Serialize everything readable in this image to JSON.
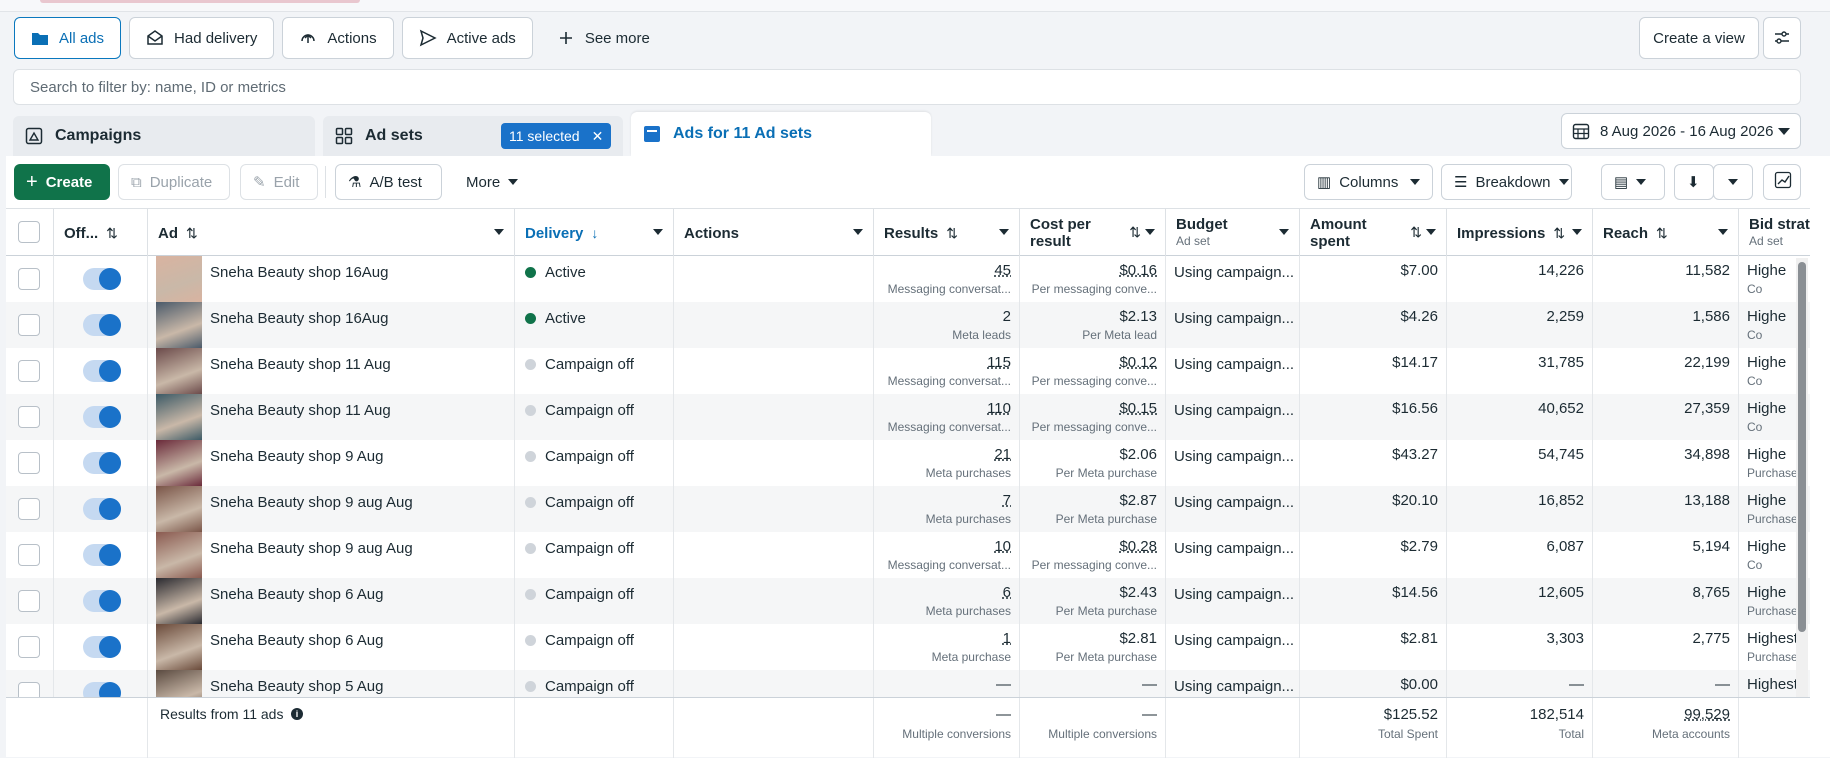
{
  "view_tabs": [
    {
      "label": "All ads",
      "icon": "folder-icon",
      "active": true
    },
    {
      "label": "Had delivery",
      "icon": "envelope-icon"
    },
    {
      "label": "Actions",
      "icon": "upload-circle-icon"
    },
    {
      "label": "Active ads",
      "icon": "send-icon"
    },
    {
      "label": "See more",
      "icon": "plus-icon"
    }
  ],
  "create_view_label": "Create a view",
  "search_placeholder": "Search to filter by: name, ID or metrics",
  "level_tabs": {
    "campaigns": "Campaigns",
    "adsets": "Ad sets",
    "selected_badge": "11 selected",
    "ads": "Ads for 11 Ad sets"
  },
  "date_range": "8 Aug 2026 - 16 Aug 2026",
  "toolbar": {
    "create": "Create",
    "duplicate": "Duplicate",
    "edit": "Edit",
    "ab_test": "A/B test",
    "more": "More",
    "columns": "Columns",
    "breakdown": "Breakdown"
  },
  "headers": {
    "off": "Off...",
    "ad": "Ad",
    "delivery": "Delivery",
    "actions": "Actions",
    "results": "Results",
    "cost_per_result_1": "Cost per",
    "cost_per_result_2": "result",
    "budget": "Budget",
    "budget_sub": "Ad set",
    "amount_1": "Amount",
    "amount_2": "spent",
    "impressions": "Impressions",
    "reach": "Reach",
    "bid": "Bid strateg",
    "bid_sub": "Ad set"
  },
  "rows": [
    {
      "name": "Sneha Beauty shop 16Aug",
      "delivery": "Active",
      "active": true,
      "results": "45",
      "results_sub": "Messaging conversat...",
      "cpr": "$0.16",
      "cpr_sub": "Per messaging conve...",
      "budget": "Using campaign...",
      "amount": "$7.00",
      "impressions": "14,226",
      "reach": "11,582",
      "bid": "Highe",
      "bid_sub": "Co",
      "thumb": "#d9b3a0"
    },
    {
      "name": "Sneha Beauty shop 16Aug",
      "delivery": "Active",
      "active": true,
      "results": "2",
      "results_sub": "Meta leads",
      "cpr": "$2.13",
      "cpr_sub": "Per Meta lead",
      "budget": "Using campaign...",
      "amount": "$4.26",
      "impressions": "2,259",
      "reach": "1,586",
      "bid": "Highe",
      "bid_sub": "Co",
      "thumb": "#4a5a6a"
    },
    {
      "name": "Sneha Beauty shop 11 Aug",
      "delivery": "Campaign off",
      "active": false,
      "results": "115",
      "results_sub": "Messaging conversat...",
      "cpr": "$0.12",
      "cpr_sub": "Per messaging conve...",
      "budget": "Using campaign...",
      "amount": "$14.17",
      "impressions": "31,785",
      "reach": "22,199",
      "bid": "Highe",
      "bid_sub": "Co",
      "thumb": "#6b4a4a"
    },
    {
      "name": "Sneha Beauty shop 11 Aug",
      "delivery": "Campaign off",
      "active": false,
      "results": "110",
      "results_sub": "Messaging conversat...",
      "cpr": "$0.15",
      "cpr_sub": "Per messaging conve...",
      "budget": "Using campaign...",
      "amount": "$16.56",
      "impressions": "40,652",
      "reach": "27,359",
      "bid": "Highe",
      "bid_sub": "Co",
      "thumb": "#3c5a66"
    },
    {
      "name": "Sneha Beauty shop 9 Aug",
      "delivery": "Campaign off",
      "active": false,
      "results": "21",
      "results_sub": "Meta purchases",
      "cpr": "$2.06",
      "cpr_sub": "Per Meta purchase",
      "budget": "Using campaign...",
      "amount": "$43.27",
      "impressions": "54,745",
      "reach": "34,898",
      "bid": "Highe",
      "bid_sub": "Purchase",
      "thumb": "#6a2a3a"
    },
    {
      "name": "Sneha Beauty shop 9 aug Aug",
      "delivery": "Campaign off",
      "active": false,
      "results": "7",
      "results_sub": "Meta purchases",
      "cpr": "$2.87",
      "cpr_sub": "Per Meta purchase",
      "budget": "Using campaign...",
      "amount": "$20.10",
      "impressions": "16,852",
      "reach": "13,188",
      "bid": "Highe",
      "bid_sub": "Purchase",
      "thumb": "#7a5548"
    },
    {
      "name": "Sneha Beauty shop 9 aug Aug",
      "delivery": "Campaign off",
      "active": false,
      "results": "10",
      "results_sub": "Messaging conversat...",
      "cpr": "$0.28",
      "cpr_sub": "Per messaging conve...",
      "budget": "Using campaign...",
      "amount": "$2.79",
      "impressions": "6,087",
      "reach": "5,194",
      "bid": "Highe",
      "bid_sub": "Co",
      "thumb": "#8a5a50"
    },
    {
      "name": "Sneha Beauty shop 6 Aug",
      "delivery": "Campaign off",
      "active": false,
      "results": "6",
      "results_sub": "Meta purchases",
      "cpr": "$2.43",
      "cpr_sub": "Per Meta purchase",
      "budget": "Using campaign...",
      "amount": "$14.56",
      "impressions": "12,605",
      "reach": "8,765",
      "bid": "Highe",
      "bid_sub": "Purchase",
      "thumb": "#2a2a30"
    },
    {
      "name": "Sneha Beauty shop 6 Aug",
      "delivery": "Campaign off",
      "active": false,
      "results": "1",
      "results_sub": "Meta purchase",
      "cpr": "$2.81",
      "cpr_sub": "Per Meta purchase",
      "budget": "Using campaign...",
      "amount": "$2.81",
      "impressions": "3,303",
      "reach": "2,775",
      "bid": "Highest",
      "bid_sub": "Purchase",
      "thumb": "#6a4a3a"
    },
    {
      "name": "Sneha Beauty shop 5 Aug",
      "delivery": "Campaign off",
      "active": false,
      "results": "—",
      "results_sub": "",
      "cpr": "—",
      "cpr_sub": "",
      "budget": "Using campaign...",
      "amount": "$0.00",
      "impressions": "—",
      "reach": "—",
      "bid": "Highest",
      "bid_sub": "",
      "thumb": "#5a4a40"
    }
  ],
  "footer": {
    "label": "Results from 11 ads",
    "results": "—",
    "results_sub": "Multiple conversions",
    "cpr": "—",
    "cpr_sub": "Multiple conversions",
    "amount": "$125.52",
    "amount_sub": "Total Spent",
    "impressions": "182,514",
    "impressions_sub": "Total",
    "reach": "99,529",
    "reach_sub": "Meta accounts"
  }
}
